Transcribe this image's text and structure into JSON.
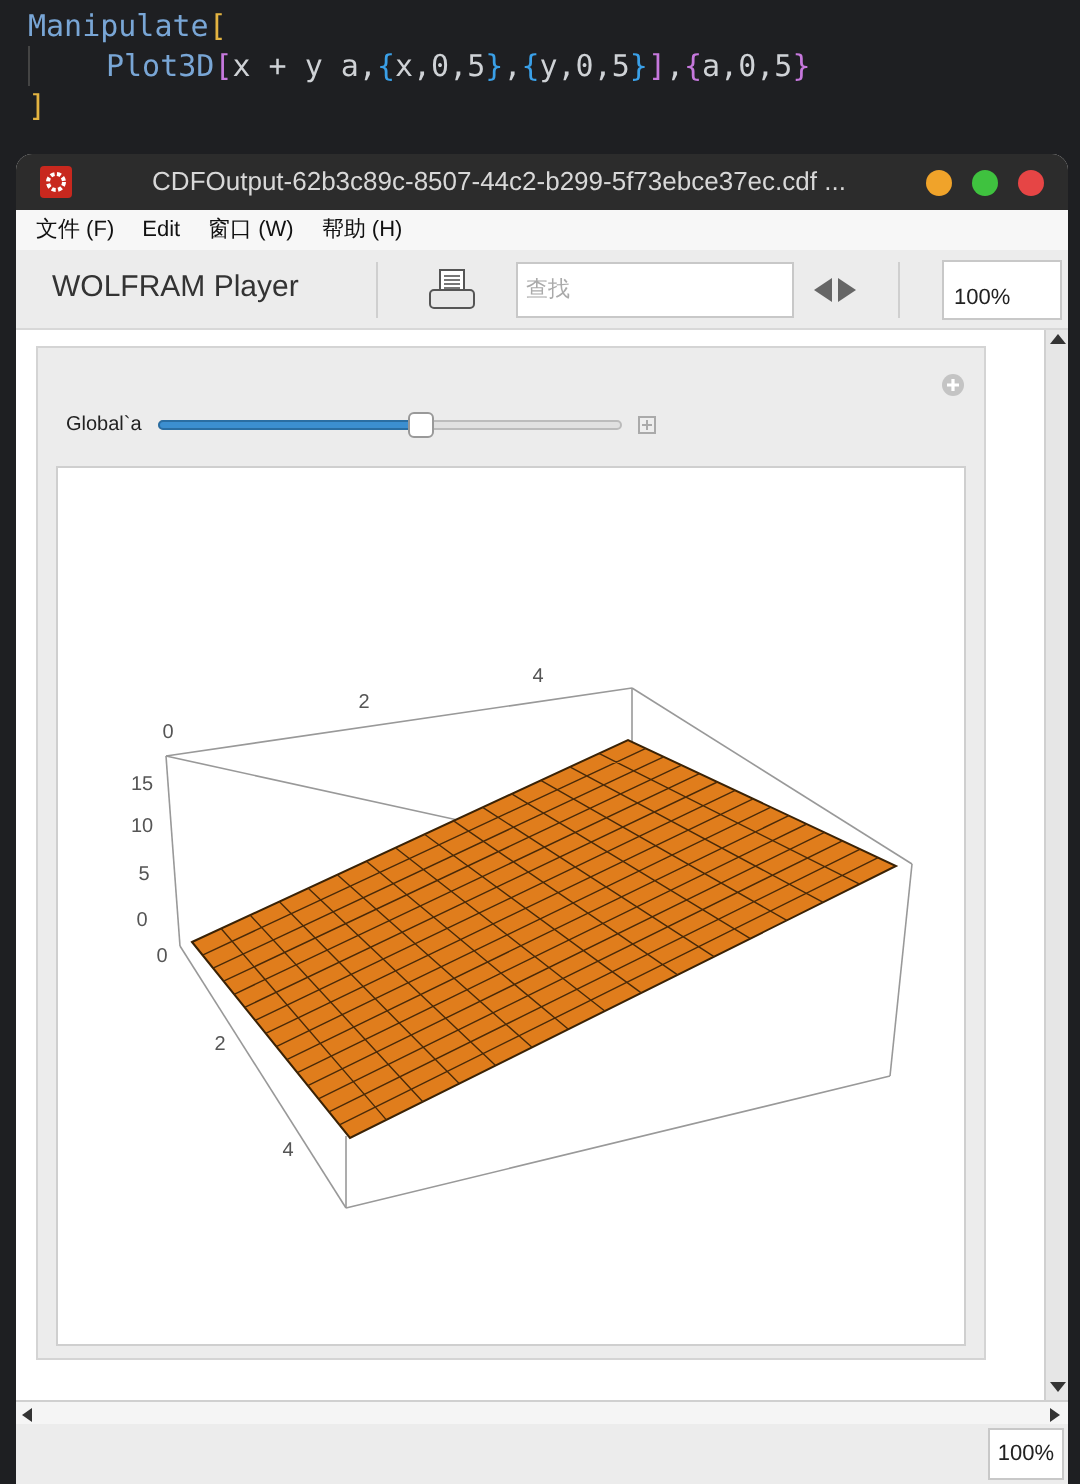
{
  "editor": {
    "lines": [
      [
        {
          "t": "Manipulate",
          "color": "#79a6d6"
        },
        {
          "t": "[",
          "color": "#e3b341"
        }
      ],
      [
        {
          "t": "Plot3D",
          "color": "#79a6d6"
        },
        {
          "t": "[",
          "color": "#c678dd"
        },
        {
          "t": "x + y a,",
          "color": "#cfd2d6"
        },
        {
          "t": "{",
          "color": "#3aa0e8"
        },
        {
          "t": "x,0,5",
          "color": "#cfd2d6"
        },
        {
          "t": "}",
          "color": "#3aa0e8"
        },
        {
          "t": ",",
          "color": "#cfd2d6"
        },
        {
          "t": "{",
          "color": "#3aa0e8"
        },
        {
          "t": "y,0,5",
          "color": "#cfd2d6"
        },
        {
          "t": "}",
          "color": "#3aa0e8"
        },
        {
          "t": "]",
          "color": "#c678dd"
        },
        {
          "t": ",",
          "color": "#cfd2d6"
        },
        {
          "t": "{",
          "color": "#c678dd"
        },
        {
          "t": "a,0,5",
          "color": "#cfd2d6"
        },
        {
          "t": "}",
          "color": "#c678dd"
        }
      ],
      [
        {
          "t": "]",
          "color": "#e3b341"
        }
      ]
    ]
  },
  "window": {
    "title": "CDFOutput-62b3c89c-8507-44c2-b299-5f73ebce37ec.cdf ...",
    "controls": [
      {
        "color": "#f0a32a"
      },
      {
        "color": "#3fc23f"
      },
      {
        "color": "#e64545"
      }
    ]
  },
  "menu": [
    {
      "label": "文件",
      "key": "(F)"
    },
    {
      "label": "Edit"
    },
    {
      "label": "窗口",
      "key": "(W)"
    },
    {
      "label": "帮助",
      "key": "(H)"
    }
  ],
  "toolbar": {
    "brand": "WOLFRAM Player",
    "search": {
      "placeholder": "查找"
    },
    "zoom": "100%"
  },
  "manipulate": {
    "control": {
      "label": "Global`a",
      "level": 0.57
    },
    "plot": {
      "top_ticks": [
        "0",
        "2",
        "4"
      ],
      "z_ticks": [
        "15",
        "10",
        "5",
        "0"
      ],
      "front_ticks": [
        "0",
        "2",
        "4"
      ]
    }
  },
  "status_bar": {
    "zoom": "100%"
  }
}
